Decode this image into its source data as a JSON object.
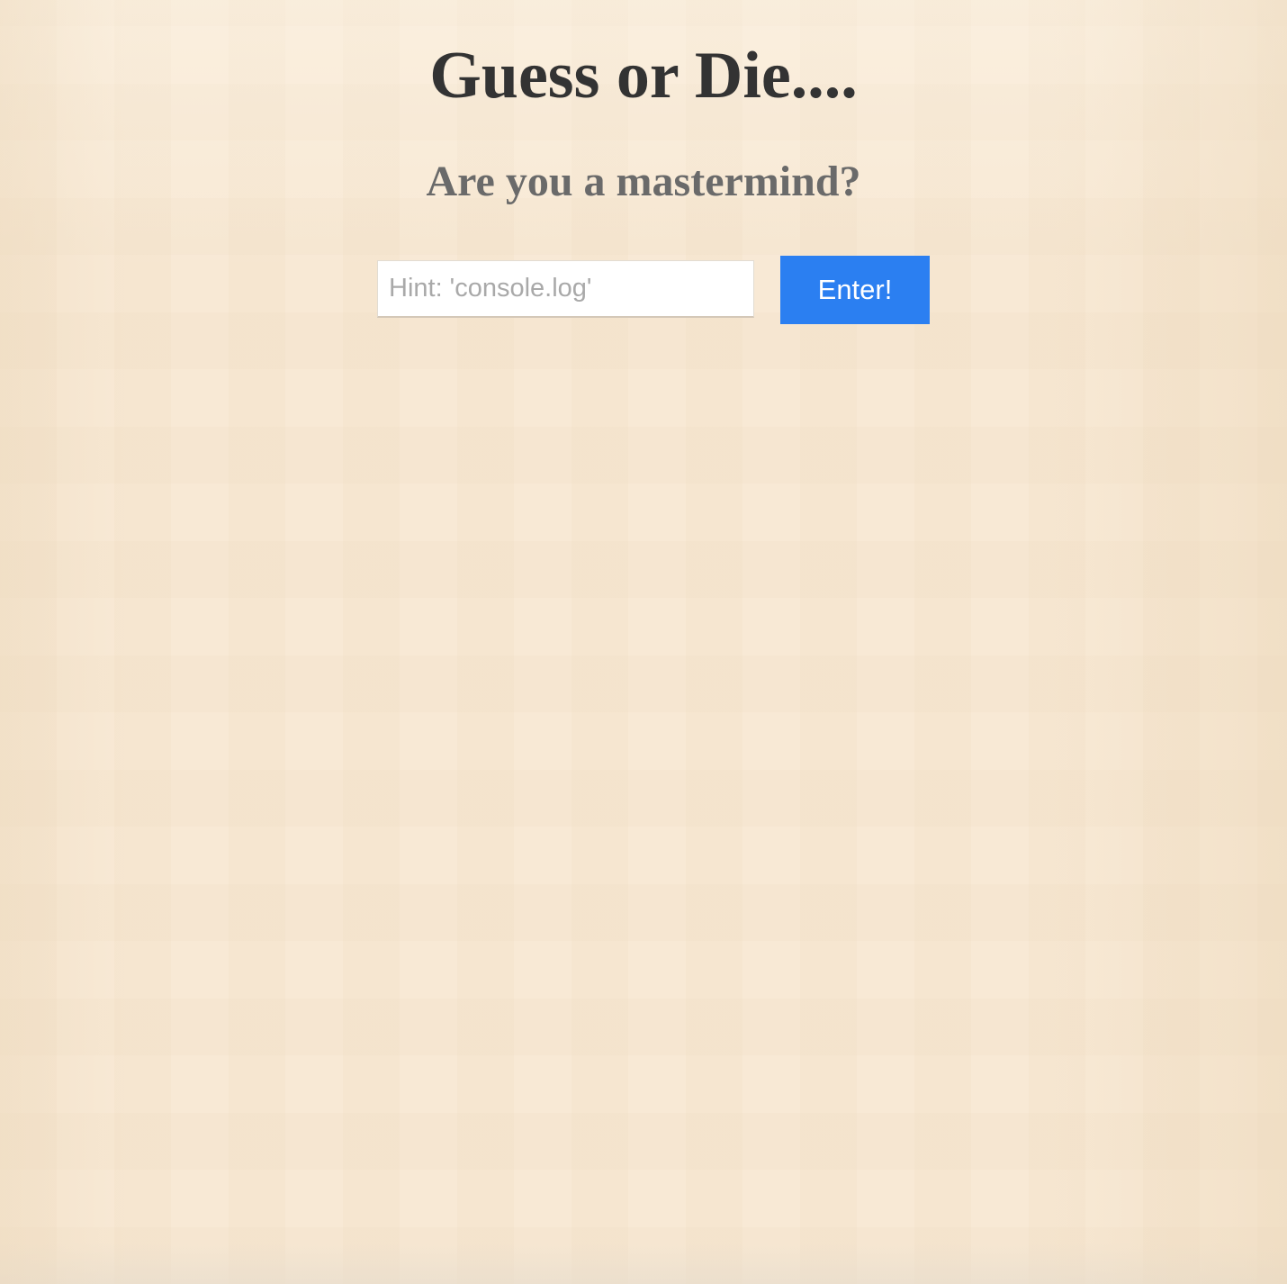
{
  "page": {
    "title": "Guess or Die....",
    "subtitle": "Are you a mastermind?"
  },
  "guess_form": {
    "input_value": "",
    "input_placeholder": "Hint: 'console.log'",
    "submit_label": "Enter!"
  },
  "colors": {
    "background": "#f8e9d5",
    "title_text": "#333333",
    "subtitle_text": "#6a6a6a",
    "button_background": "#2b7ff1",
    "button_text": "#ffffff"
  }
}
